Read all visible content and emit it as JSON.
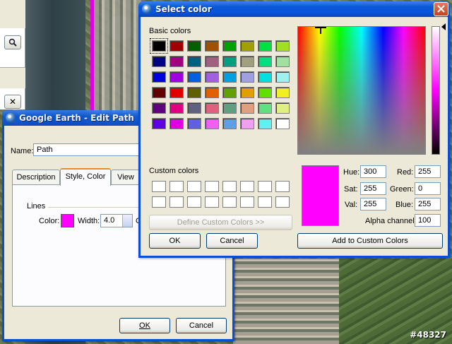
{
  "watermark": "#48327",
  "side_panel": {
    "close_glyph": "✕"
  },
  "edit_path": {
    "title": "Google Earth - Edit Path",
    "name_label": "Name:",
    "name_value": "Path",
    "tabs": [
      {
        "label": "Description"
      },
      {
        "label": "Style, Color"
      },
      {
        "label": "View"
      }
    ],
    "lines_group": "Lines",
    "color_label": "Color:",
    "width_label": "Width:",
    "width_value": "4.0",
    "opacity_label_fragment": "O",
    "ok": "OK",
    "cancel": "Cancel",
    "line_color": "#ff00ff"
  },
  "select_color": {
    "title": "Select color",
    "basic_colors_label": "Basic colors",
    "custom_colors_label": "Custom colors",
    "define_custom": "Define Custom Colors >>",
    "ok": "OK",
    "cancel": "Cancel",
    "add_custom": "Add to Custom Colors",
    "hue_label": "Hue:",
    "hue_value": "300",
    "sat_label": "Sat:",
    "sat_value": "255",
    "val_label": "Val:",
    "val_value": "255",
    "red_label": "Red:",
    "red_value": "255",
    "green_label": "Green:",
    "green_value": "0",
    "blue_label": "Blue:",
    "blue_value": "255",
    "alpha_label": "Alpha channel:",
    "alpha_value": "100",
    "current_color": "#ff00ff",
    "basic_colors": [
      [
        "#000000",
        "#a00000",
        "#006000",
        "#a05000",
        "#00a000",
        "#a0a000",
        "#00e040",
        "#a0e020"
      ],
      [
        "#000080",
        "#a00080",
        "#006080",
        "#a06080",
        "#00a080",
        "#a0a080",
        "#00e080",
        "#a0e0a0"
      ],
      [
        "#0000e0",
        "#a000e0",
        "#0060e0",
        "#a060e0",
        "#00a0e0",
        "#a0a0e0",
        "#00e0e0",
        "#a0f0f0"
      ],
      [
        "#600000",
        "#e00000",
        "#606000",
        "#e06000",
        "#60a000",
        "#e0a000",
        "#60e000",
        "#f0f020"
      ],
      [
        "#600080",
        "#e00080",
        "#606080",
        "#e06080",
        "#60a080",
        "#e0a080",
        "#60e080",
        "#e0f080"
      ],
      [
        "#6000e0",
        "#e000e0",
        "#6060e0",
        "#f060f0",
        "#60a0e0",
        "#f0a0f0",
        "#60f0f0",
        "#ffffff"
      ]
    ]
  }
}
